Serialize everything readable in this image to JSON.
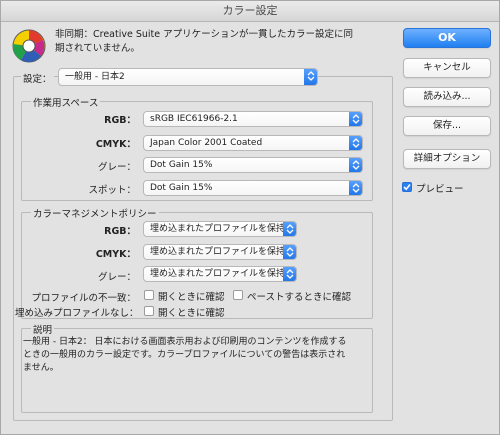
{
  "window": {
    "title": "カラー設定"
  },
  "sync": {
    "text": "非同期：Creative Suite アプリケーションが一貫したカラー設定に同期されていません。"
  },
  "buttons": {
    "ok": "OK",
    "cancel": "キャンセル",
    "load": "読み込み...",
    "save": "保存...",
    "advanced": "詳細オプション"
  },
  "preview": {
    "label": "プレビュー",
    "checked": true
  },
  "settings": {
    "label": "設定：",
    "value": "一般用 - 日本2"
  },
  "working_spaces": {
    "title": "作業用スペース",
    "rows": [
      {
        "label": "RGB：",
        "value": "sRGB IEC61966-2.1"
      },
      {
        "label": "CMYK：",
        "value": "Japan Color 2001 Coated"
      },
      {
        "label": "グレー：",
        "value": "Dot Gain 15%"
      },
      {
        "label": "スポット：",
        "value": "Dot Gain 15%"
      }
    ]
  },
  "color_management": {
    "title": "カラーマネジメントポリシー",
    "rows": [
      {
        "label": "RGB：",
        "value": "埋め込まれたプロファイルを保持"
      },
      {
        "label": "CMYK：",
        "value": "埋め込まれたプロファイルを保持"
      },
      {
        "label": "グレー：",
        "value": "埋め込まれたプロファイルを保持"
      }
    ],
    "mismatch_label": "プロファイルの不一致：",
    "mismatch_open": "開くときに確認",
    "mismatch_paste": "ペーストするときに確認",
    "missing_label": "埋め込みプロファイルなし：",
    "missing_open": "開くときに確認"
  },
  "description": {
    "title": "説明",
    "text": "一般用 - 日本2： 日本における画面表示用および印刷用のコンテンツを作成するときの一般用のカラー設定です。カラープロファイルについての警告は表示されません。"
  },
  "colors": {
    "accent": "#1f7ff0",
    "background": "#e2e2e2"
  }
}
